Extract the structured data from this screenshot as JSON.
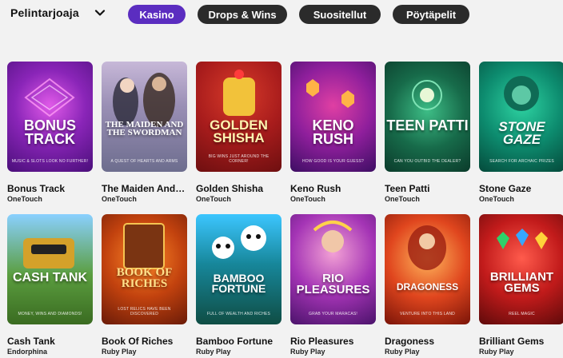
{
  "toolbar": {
    "provider_label": "Pelintarjoaja",
    "tabs": [
      {
        "label": "Kasino",
        "active": true
      },
      {
        "label": "Drops & Wins",
        "active": false
      },
      {
        "label": "Suositellut",
        "active": false
      },
      {
        "label": "Pöytäpelit",
        "active": false
      }
    ]
  },
  "colors": {
    "accent": "#5b2dc0",
    "chip": "#2b2b2b",
    "background": "#f2f2f2"
  },
  "games": [
    {
      "title": "Bonus Track",
      "provider": "OneTouch",
      "art_title": "BONUS TRACK",
      "art_tagline": "MUSIC & SLOTS LOOK NO FURTHER!"
    },
    {
      "title": "The Maiden And The Swordman",
      "provider": "OneTouch",
      "art_title": "THE MAIDEN AND THE SWORDMAN",
      "art_tagline": "A QUEST OF HEARTS AND ARMS"
    },
    {
      "title": "Golden Shisha",
      "provider": "OneTouch",
      "art_title": "GOLDEN SHISHA",
      "art_tagline": "BIG WINS JUST AROUND THE CORNER!"
    },
    {
      "title": "Keno Rush",
      "provider": "OneTouch",
      "art_title": "KENO RUSH",
      "art_tagline": "HOW GOOD IS YOUR GUESS?"
    },
    {
      "title": "Teen Patti",
      "provider": "OneTouch",
      "art_title": "TEEN PATTI",
      "art_tagline": "CAN YOU OUTBID THE DEALER?"
    },
    {
      "title": "Stone Gaze",
      "provider": "OneTouch",
      "art_title": "STONE GAZE",
      "art_tagline": "SEARCH FOR ARCHAIC PRIZES"
    },
    {
      "title": "Cash Tank",
      "provider": "Endorphina",
      "art_title": "CASH TANK",
      "art_tagline": "MONEY, WINS AND DIAMONDS!"
    },
    {
      "title": "Book Of Riches",
      "provider": "Ruby Play",
      "art_title": "BOOK OF RICHES",
      "art_tagline": "LOST RELICS HAVE BEEN DISCOVERED"
    },
    {
      "title": "Bamboo Fortune",
      "provider": "Ruby Play",
      "art_title": "BAMBOO FORTUNE",
      "art_tagline": "FULL OF WEALTH AND RICHES"
    },
    {
      "title": "Rio Pleasures",
      "provider": "Ruby Play",
      "art_title": "RIO PLEASURES",
      "art_tagline": "GRAB YOUR MARACAS!"
    },
    {
      "title": "Dragoness",
      "provider": "Ruby Play",
      "art_title": "DRAGONESS",
      "art_tagline": "VENTURE INTO THIS LAND"
    },
    {
      "title": "Brilliant Gems",
      "provider": "Ruby Play",
      "art_title": "BRILLIANT GEMS",
      "art_tagline": "REEL MAGIC"
    }
  ]
}
